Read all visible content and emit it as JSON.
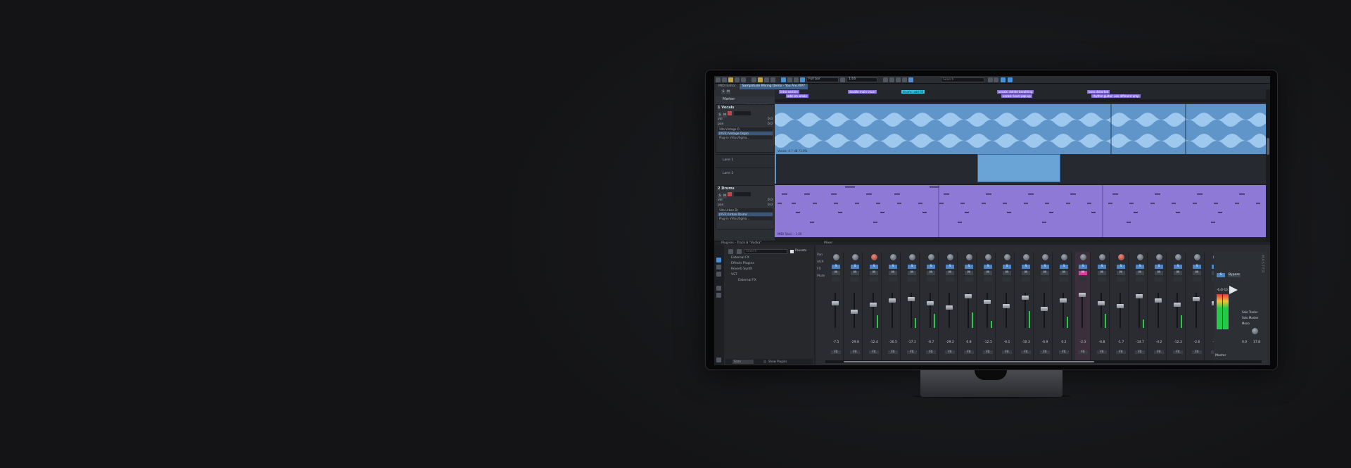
{
  "toolbar": {
    "zoom_mode": "Full bar",
    "grid": "1/16",
    "search_placeholder": "Search",
    "accent": "#4a90d9"
  },
  "tabs": [
    {
      "label": "MIDI Editor",
      "active": false
    },
    {
      "label": "Samplitude Mixing Demo - You Are.VIP7",
      "active": true
    }
  ],
  "marker_lane": {
    "label": "Marker",
    "markers": [
      {
        "label": "intro section",
        "color": "purple"
      },
      {
        "label": "add sm whole",
        "color": "purple"
      },
      {
        "label": "double main vocal",
        "color": "purple"
      },
      {
        "label": "drums: add fill",
        "color": "cyan"
      },
      {
        "label": "vocals: delete breathing",
        "color": "purple"
      },
      {
        "label": "vocals: level pop up",
        "color": "purple"
      },
      {
        "label": "bass distorted",
        "color": "purple"
      },
      {
        "label": "rhythm guitar: use different amp",
        "color": "purple"
      }
    ]
  },
  "tracks": [
    {
      "number": "1",
      "name": "Vocals",
      "vol": "0.0",
      "pan": "0.0",
      "plugins": [
        "Vita Vintage O",
        "(VSTi) Vintage Organ",
        "Plug-in Virtus/Sgma..."
      ],
      "lanes": [
        "Lane 1",
        "Lane 2"
      ],
      "object_label": "Vocals -4.7 dB 73.0%",
      "color": "#5f95c8"
    },
    {
      "number": "2",
      "name": "Drums",
      "vol": "0.0",
      "pan": "0.0",
      "plugins": [
        "Vita Urban Dr",
        "(VSTi) Urban Drums",
        "Plug-in Virtus/Sgma..."
      ],
      "object_label": "MIDI Take1 - 1.00",
      "color": "#8e7ad6"
    }
  ],
  "plugin_browser": {
    "title": "Plug-ins - Track 8 \"Vodka\"",
    "search_placeholder": "Search",
    "presets_label": "Presets",
    "items": [
      "External FX",
      "Effects Plugins",
      "Reverb Synth",
      "VST",
      "External FX"
    ],
    "show_plugins": "Show Plugins",
    "footer_select": "Scan"
  },
  "mixer": {
    "title": "Mixer",
    "rows": [
      "Pan",
      "AUX",
      "FX",
      "Mute"
    ],
    "strips": [
      {
        "value": "-7.5",
        "fx": "FX",
        "pan_color": "gray",
        "solo": false
      },
      {
        "value": "-29.8",
        "fx": "FX",
        "pan_color": "gray",
        "solo": false
      },
      {
        "value": "-12.4",
        "fx": "FX",
        "pan_color": "red",
        "solo": false
      },
      {
        "value": "-16.5",
        "fx": "FX",
        "pan_color": "gray",
        "solo": false
      },
      {
        "value": "-17.1",
        "fx": "FX",
        "pan_color": "gray",
        "solo": false
      },
      {
        "value": "-6.7",
        "fx": "FX",
        "pan_color": "gray",
        "solo": false
      },
      {
        "value": "-29.2",
        "fx": "FX",
        "pan_color": "gray",
        "solo": false
      },
      {
        "value": "0.8",
        "fx": "FX",
        "pan_color": "gray",
        "solo": false
      },
      {
        "value": "-12.5",
        "fx": "FX",
        "pan_color": "gray",
        "solo": false
      },
      {
        "value": "-6.1",
        "fx": "FX",
        "pan_color": "gray",
        "solo": false
      },
      {
        "value": "-10.3",
        "fx": "FX",
        "pan_color": "gray",
        "solo": false
      },
      {
        "value": "-6.9",
        "fx": "FX",
        "pan_color": "gray",
        "solo": false
      },
      {
        "value": "0.2",
        "fx": "FX",
        "pan_color": "gray",
        "solo": false
      },
      {
        "value": "-2.3",
        "fx": "FX",
        "pan_color": "gray",
        "solo": true
      },
      {
        "value": "-6.8",
        "fx": "FX",
        "pan_color": "gray",
        "solo": false
      },
      {
        "value": "-1.7",
        "fx": "FX",
        "pan_color": "red",
        "solo": false
      },
      {
        "value": "-14.7",
        "fx": "FX",
        "pan_color": "gray",
        "solo": false
      },
      {
        "value": "-4.2",
        "fx": "FX",
        "pan_color": "gray",
        "solo": false
      },
      {
        "value": "-12.3",
        "fx": "FX",
        "pan_color": "gray",
        "solo": false
      },
      {
        "value": "-2.6",
        "fx": "FX",
        "pan_color": "gray",
        "solo": false
      },
      {
        "value": "-8.1",
        "fx": "FX",
        "pan_color": "gray",
        "solo": false
      }
    ],
    "master": {
      "label": "MASTER",
      "name": "Master",
      "bypass": "Bypass",
      "solo_tracks": "Solo Tracks",
      "solo_master": "Solo Master",
      "mode": "Mono",
      "value_l": "0.0",
      "value_r": "17.8",
      "peak": "-6.4/-10.1"
    }
  }
}
